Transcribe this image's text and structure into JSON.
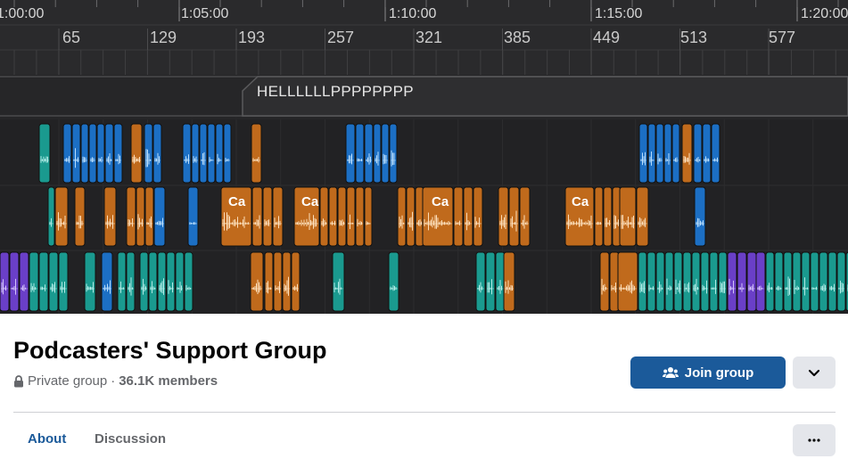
{
  "timeline": {
    "timecodes": [
      "1:00:00",
      "1:05:00",
      "1:10:00",
      "1:15:00",
      "1:20:00"
    ],
    "beats": [
      "65",
      "129",
      "193",
      "257",
      "321",
      "385",
      "449",
      "513",
      "577"
    ],
    "marker_text": "HELLLLLLPPPPPPPP",
    "clip_title": "Ca"
  },
  "group": {
    "name": "Podcasters' Support Group",
    "privacy": "Private group",
    "separator": "·",
    "members": "36.1K members"
  },
  "actions": {
    "join_label": "Join group"
  },
  "tabs": [
    {
      "label": "About",
      "active": true
    },
    {
      "label": "Discussion",
      "active": false
    }
  ],
  "colors": {
    "accent": "#1b5a9a",
    "clip_blue": "#1c6fc4",
    "clip_orange": "#c06a1c",
    "clip_teal": "#1a9a8f",
    "clip_purple": "#6a3fc8"
  },
  "icons": [
    "lock-icon",
    "group-people-icon",
    "chevron-down-icon",
    "more-dots-icon"
  ]
}
